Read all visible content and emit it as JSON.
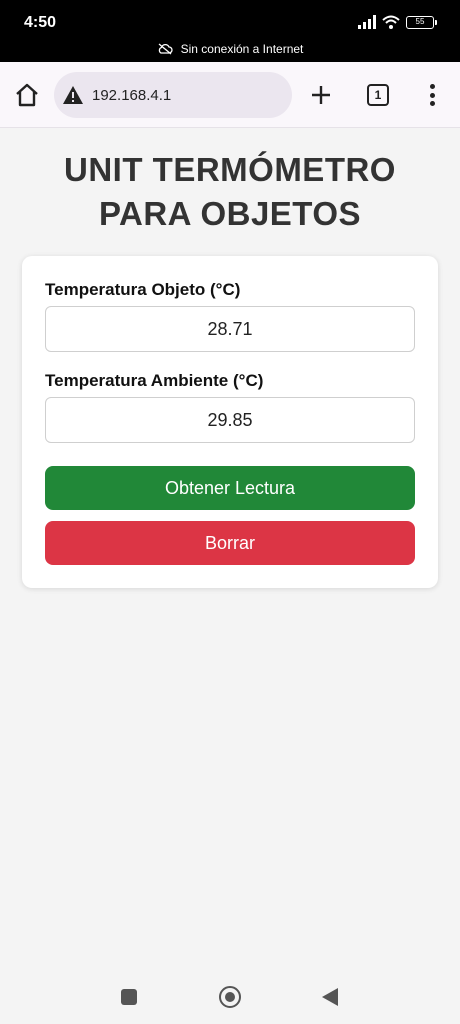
{
  "status_bar": {
    "time": "4:50",
    "battery": "55",
    "network_message": "Sin conexión a Internet"
  },
  "browser": {
    "url": "192.168.4.1",
    "tab_count": "1"
  },
  "page": {
    "title_line1": "UNIT TERMÓMETRO",
    "title_line2": "PARA OBJETOS"
  },
  "form": {
    "object_label": "Temperatura Objeto (°C)",
    "object_value": "28.71",
    "ambient_label": "Temperatura Ambiente (°C)",
    "ambient_value": "29.85",
    "read_button": "Obtener Lectura",
    "clear_button": "Borrar"
  },
  "colors": {
    "read_button": "#218838",
    "clear_button": "#dc3545",
    "title": "#333333"
  }
}
